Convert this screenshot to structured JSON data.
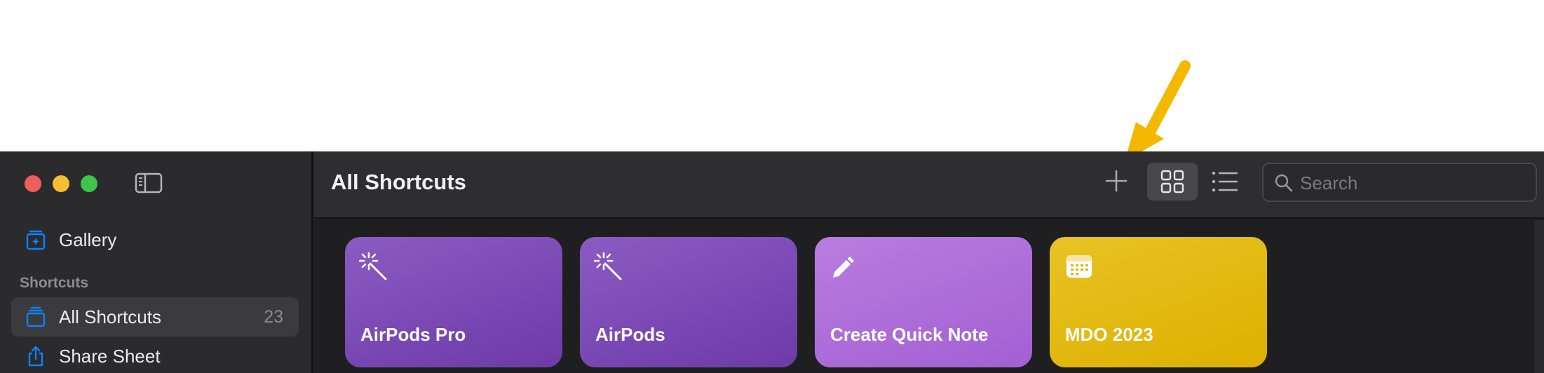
{
  "sidebar": {
    "gallery_label": "Gallery",
    "section_label": "Shortcuts",
    "items": [
      {
        "label": "All Shortcuts",
        "count": "23",
        "icon": "stack-icon",
        "selected": true
      },
      {
        "label": "Share Sheet",
        "icon": "share-icon",
        "selected": false
      }
    ]
  },
  "toolbar": {
    "title": "All Shortcuts",
    "add_icon": "plus-icon",
    "view_grid_icon": "grid-icon",
    "view_list_icon": "list-icon",
    "search_placeholder": "Search"
  },
  "cards": [
    {
      "name": "AirPods Pro",
      "icon": "magic-wand-icon",
      "color_top": "#8b5bc3",
      "color_bottom": "#6d3aa8"
    },
    {
      "name": "AirPods",
      "icon": "magic-wand-icon",
      "color_top": "#8b5bc3",
      "color_bottom": "#6d3aa8"
    },
    {
      "name": "Create Quick Note",
      "icon": "pencil-icon",
      "color_top": "#b97de0",
      "color_bottom": "#a35fd3"
    },
    {
      "name": "MDO 2023",
      "icon": "calendar-icon",
      "color_top": "#e8c325",
      "color_bottom": "#ddb000"
    }
  ],
  "colors": {
    "accent": "#0a84ff",
    "arrow": "#f5b800"
  }
}
